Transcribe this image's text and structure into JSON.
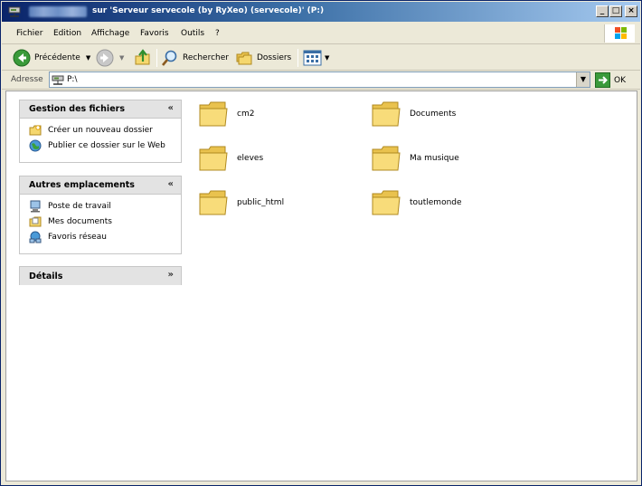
{
  "window": {
    "title": "sur 'Serveur servecole (by RyXeo) (servecole)' (P:)",
    "caption_buttons": [
      "_",
      "□",
      "×"
    ]
  },
  "menubar": {
    "items": [
      "Fichier",
      "Edition",
      "Affichage",
      "Favoris",
      "Outils",
      "?"
    ]
  },
  "toolbar": {
    "back_label": "Précédente",
    "search_label": "Rechercher",
    "folders_label": "Dossiers"
  },
  "addressbar": {
    "label": "Adresse",
    "value": "P:\\",
    "go_label": "OK"
  },
  "panes": {
    "file_tasks": {
      "title": "Gestion des fichiers",
      "links": [
        {
          "label": "Créer un nouveau dossier",
          "icon": "new-folder-icon"
        },
        {
          "label": "Publier ce dossier sur le Web",
          "icon": "web-publish-icon"
        }
      ]
    },
    "other_places": {
      "title": "Autres emplacements",
      "links": [
        {
          "label": "Poste de travail",
          "icon": "my-computer-icon"
        },
        {
          "label": "Mes documents",
          "icon": "my-documents-icon"
        },
        {
          "label": "Favoris réseau",
          "icon": "network-places-icon"
        }
      ]
    },
    "details": {
      "title": "Détails"
    }
  },
  "folders": [
    {
      "name": "cm2"
    },
    {
      "name": "Documents"
    },
    {
      "name": "eleves"
    },
    {
      "name": "Ma musique"
    },
    {
      "name": "public_html"
    },
    {
      "name": "toutlemonde"
    }
  ],
  "colors": {
    "titlebar_start": "#0a246a",
    "titlebar_end": "#a6caf0",
    "chrome": "#ece9d8",
    "folder_yellow": "#f5d76e"
  }
}
